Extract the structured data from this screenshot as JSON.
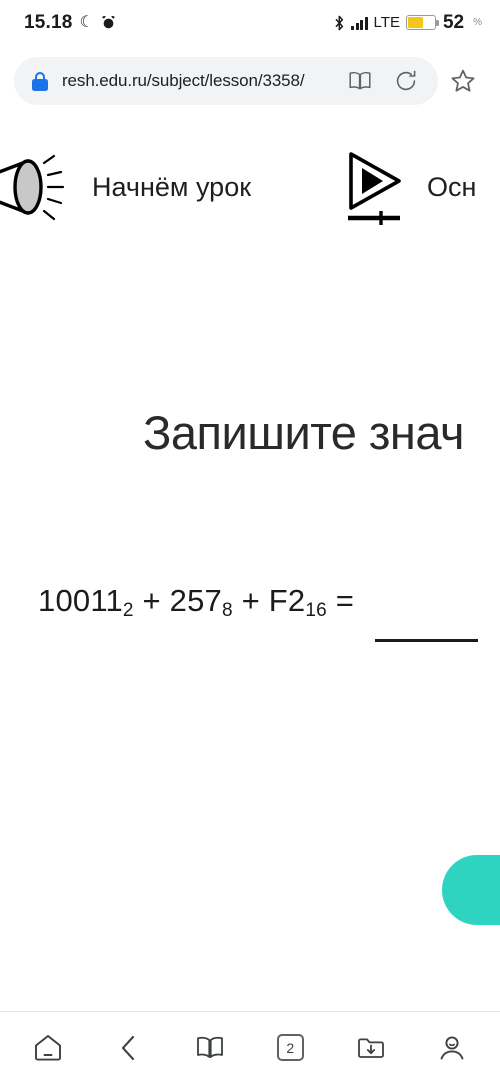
{
  "status_bar": {
    "clock": "15.18",
    "moon_icon": "crescent-moon-icon",
    "alarm_icon": "alarm-clock-icon",
    "bluetooth_icon": "bluetooth-icon",
    "signal_icon": "signal-bars-icon",
    "network": "LTE",
    "battery_icon": "battery-icon",
    "battery_percent": "52",
    "percent_symbol": "%",
    "battery_color": "#f5c518"
  },
  "browser": {
    "lock_icon": "lock-icon",
    "url": "resh.edu.ru/subject/lesson/3358/",
    "reader_icon": "reader-book-icon",
    "reload_icon": "reload-icon",
    "bookmark_icon": "star-outline-icon"
  },
  "lesson_nav": {
    "items": [
      {
        "icon": "megaphone-icon",
        "label": "Начнём урок"
      },
      {
        "icon": "play-progress-icon",
        "label": "Осн"
      }
    ]
  },
  "task": {
    "title": "Запишите знач",
    "formula": {
      "term1": "10011",
      "base1": "2",
      "op1": "+",
      "term2": "257",
      "base2": "8",
      "op2": "+",
      "term3": "F2",
      "base3": "16",
      "equals": "="
    },
    "answer_value": "",
    "submit_button_color": "#2ed4c0"
  },
  "bottom_bar": {
    "items": [
      {
        "icon": "home-icon",
        "label": ""
      },
      {
        "icon": "back-chevron-icon",
        "label": ""
      },
      {
        "icon": "reader-book-icon",
        "label": ""
      },
      {
        "icon": "tabs-icon",
        "label": "2"
      },
      {
        "icon": "downloads-folder-icon",
        "label": ""
      },
      {
        "icon": "profile-person-icon",
        "label": ""
      }
    ]
  }
}
